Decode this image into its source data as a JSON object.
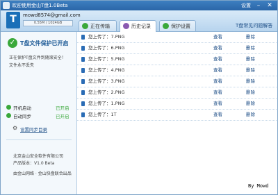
{
  "window": {
    "title": "欢迎使用金山T盘1.0Beta",
    "settings_label": "设置",
    "minimize_glyph": "–",
    "close_glyph": "✕"
  },
  "account": {
    "email": "mowd8574@gmail.com",
    "usage": "0.55M / 1024GB",
    "avatar_letter": "T"
  },
  "tabs": [
    {
      "label": "正在传输",
      "icon": "transfer-icon",
      "color": "#3aa83a"
    },
    {
      "label": "历史记录",
      "icon": "history-icon",
      "color": "#8a5ab0"
    },
    {
      "label": "保护设置",
      "icon": "shield-icon",
      "color": "#3aa83a"
    }
  ],
  "help_link": "T盘常见问题解答",
  "status": {
    "title": "T盘文件保护已开启",
    "desc_lines": [
      "正在保护T盘文件到随滚安全！",
      "文件永不丢失"
    ]
  },
  "features": [
    {
      "label": "开机启动",
      "state": "已开启"
    },
    {
      "label": "自动同步",
      "state": "已开启"
    }
  ],
  "sync_link": "设置同步目录",
  "about": {
    "company": "北京金山安全软件有限公司",
    "version": "产品版本：V1.0 Beta",
    "publisher": "由金山网络 · 金山快盘联合出品"
  },
  "history": {
    "actions": [
      "查看",
      "删除"
    ],
    "rows": [
      {
        "name": "您上传了：7.PNG"
      },
      {
        "name": "您上传了：6.PNG"
      },
      {
        "name": "您上传了：5.PNG"
      },
      {
        "name": "您上传了：4.PNG"
      },
      {
        "name": "您上传了：3.PNG"
      },
      {
        "name": "您上传了：2.PNG"
      },
      {
        "name": "您上传了：1.PNG"
      },
      {
        "name": "您上传了：1T"
      }
    ]
  },
  "byline": "By Mowd",
  "colors": {
    "accent": "#2b66a8",
    "ok": "#3aa83a",
    "link": "#1c4d86"
  }
}
